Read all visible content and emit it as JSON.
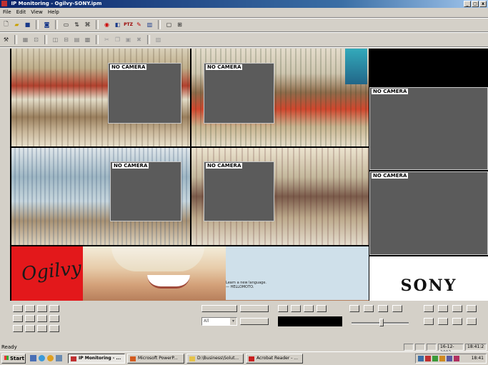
{
  "window": {
    "title": "IP Monitoring - Ogilvy-SONY.ipm",
    "controls": [
      "_",
      "Ф",
      "x"
    ]
  },
  "menu": [
    "File",
    "Edit",
    "View",
    "Help"
  ],
  "toolbar": {
    "ptz_label": "PTZ"
  },
  "viewer": {
    "no_camera_label": "NO CAMERA",
    "banner": {
      "ogilvy_logo": "Ogilvy",
      "sony_logo": "SONY",
      "tagline_1": "Learn a new language.",
      "tagline_2": "— HELLOMOTO."
    }
  },
  "controls": {
    "preset_select": "All"
  },
  "status": {
    "left": "Ready",
    "date": "16-12-2002",
    "time": "18:41:2"
  },
  "taskbar": {
    "start": "Start",
    "tasks": [
      "IP Monitoring - ...",
      "Microsoft PowerP...",
      "D:\\Business\\Solut...",
      "Acrobat Reader - ..."
    ],
    "clock": "18:41"
  },
  "colors": {
    "title_bar": "#0a246a",
    "ogilvy_red": "#e3181b",
    "panel_gray": "#5b5b5b"
  }
}
